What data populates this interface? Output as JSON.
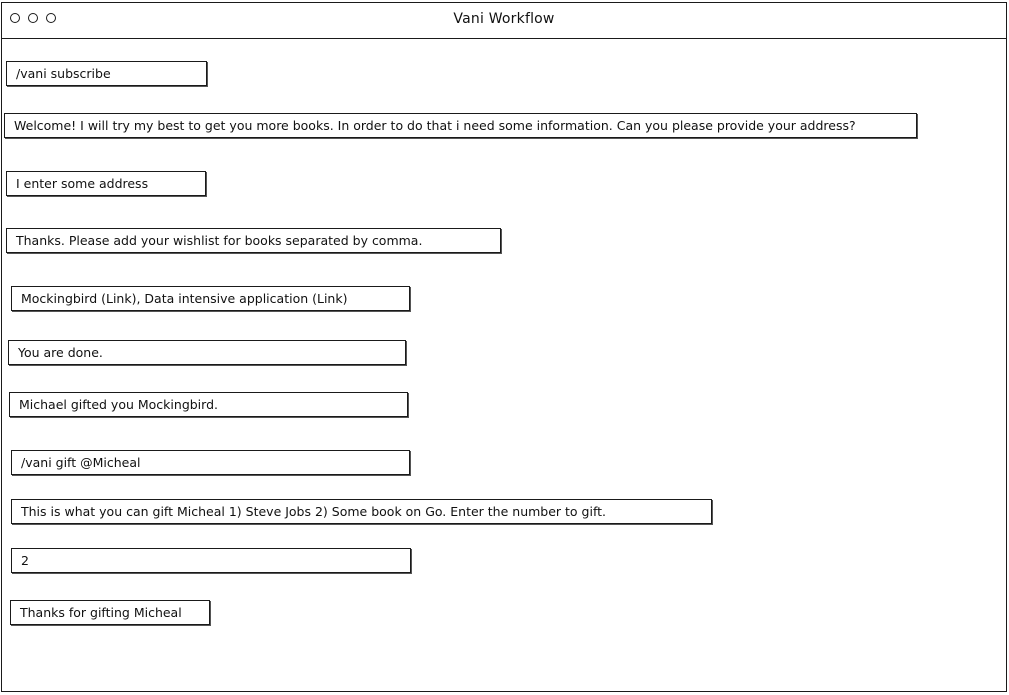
{
  "window": {
    "title": "Vani Workflow"
  },
  "messages": [
    "/vani subscribe",
    "Welcome! I will try my best to get you more books. In order to do that i need some information. Can you please provide your address?",
    "I enter some address",
    "Thanks. Please add your wishlist for books separated by comma.",
    "Mockingbird (Link), Data intensive application (Link)",
    "You are done.",
    "Michael gifted you Mockingbird.",
    "/vani gift @Micheal",
    "This is what you can gift Micheal 1) Steve Jobs 2) Some book on Go. Enter the number to gift.",
    "2",
    "Thanks for gifting Micheal"
  ]
}
